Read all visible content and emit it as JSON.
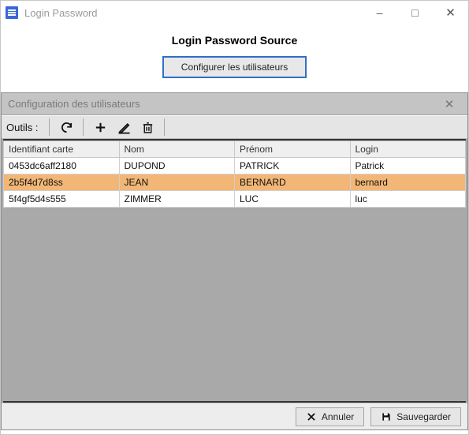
{
  "window": {
    "title": "Login Password",
    "main_title": "Login Password Source",
    "configure_btn": "Configurer les utilisateurs"
  },
  "sub_panel": {
    "title": "Configuration des utilisateurs",
    "toolbar_label": "Outils :"
  },
  "table": {
    "headers": {
      "id": "Identifiant carte",
      "nom": "Nom",
      "prenom": "Prénom",
      "login": "Login"
    },
    "rows": [
      {
        "id": "0453dc6aff2180",
        "nom": "DUPOND",
        "prenom": "PATRICK",
        "login": "Patrick",
        "selected": false
      },
      {
        "id": "2b5f4d7d8ss",
        "nom": "JEAN",
        "prenom": "BERNARD",
        "login": "bernard",
        "selected": true
      },
      {
        "id": "5f4gf5d4s555",
        "nom": "ZIMMER",
        "prenom": "LUC",
        "login": "luc",
        "selected": false
      }
    ]
  },
  "footer": {
    "cancel": "Annuler",
    "save": "Sauvegarder"
  }
}
